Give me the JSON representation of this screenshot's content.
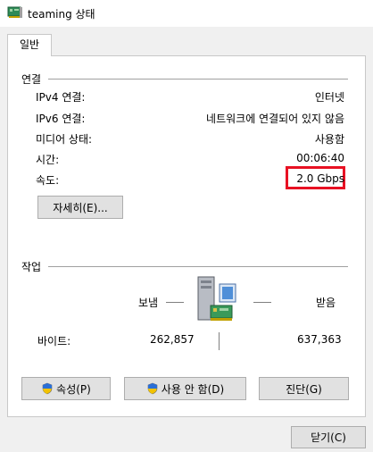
{
  "window": {
    "title": "teaming 상태"
  },
  "tabs": [
    {
      "label": "일반"
    }
  ],
  "connection": {
    "section_label": "연결",
    "rows": [
      {
        "label": "IPv4 연결:",
        "value": "인터넷"
      },
      {
        "label": "IPv6 연결:",
        "value": "네트워크에 연결되어 있지 않음"
      },
      {
        "label": "미디어 상태:",
        "value": "사용함"
      },
      {
        "label": "시간:",
        "value": "00:06:40"
      },
      {
        "label": "속도:",
        "value": "2.0 Gbps"
      }
    ],
    "details_button": "자세히(E)..."
  },
  "activity": {
    "section_label": "작업",
    "sent_label": "보냄",
    "received_label": "받음",
    "bytes_label": "바이트:",
    "bytes_sent": "262,857",
    "bytes_received": "637,363"
  },
  "buttons": {
    "properties": "속성(P)",
    "disable": "사용 안 함(D)",
    "diagnose": "진단(G)",
    "close": "닫기(C)"
  },
  "highlight_color": "#e81123",
  "icons": [
    "network-adapter-icon",
    "computer-network-icon",
    "uac-shield-icon"
  ]
}
